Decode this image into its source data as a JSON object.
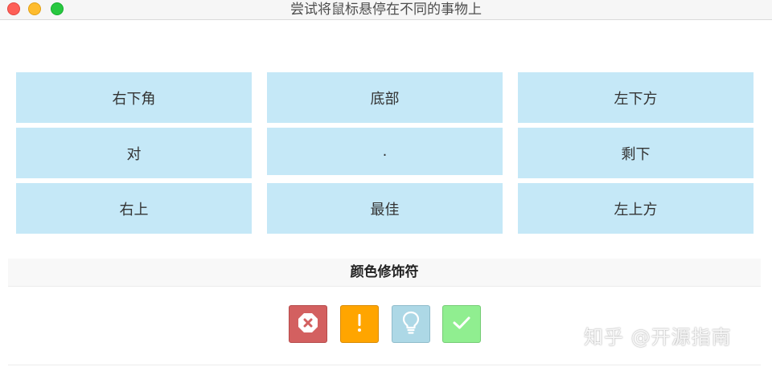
{
  "window": {
    "title": "尝试将鼠标悬停在不同的事物上"
  },
  "grid": {
    "tiles": [
      "右下角",
      "底部",
      "左下方",
      "对",
      ".",
      "剩下",
      "右上",
      "最佳",
      "左上方"
    ]
  },
  "modifiers": {
    "heading": "颜色修饰符",
    "buttons": [
      {
        "kind": "error",
        "icon": "x-octagon-icon",
        "color": "#d36060"
      },
      {
        "kind": "warning",
        "icon": "exclamation-icon",
        "color": "#ffa500"
      },
      {
        "kind": "info",
        "icon": "lightbulb-icon",
        "color": "#add8e6"
      },
      {
        "kind": "success",
        "icon": "checkmark-icon",
        "color": "#90ee90"
      }
    ]
  },
  "watermark": {
    "text": "知乎 @开源指南"
  }
}
